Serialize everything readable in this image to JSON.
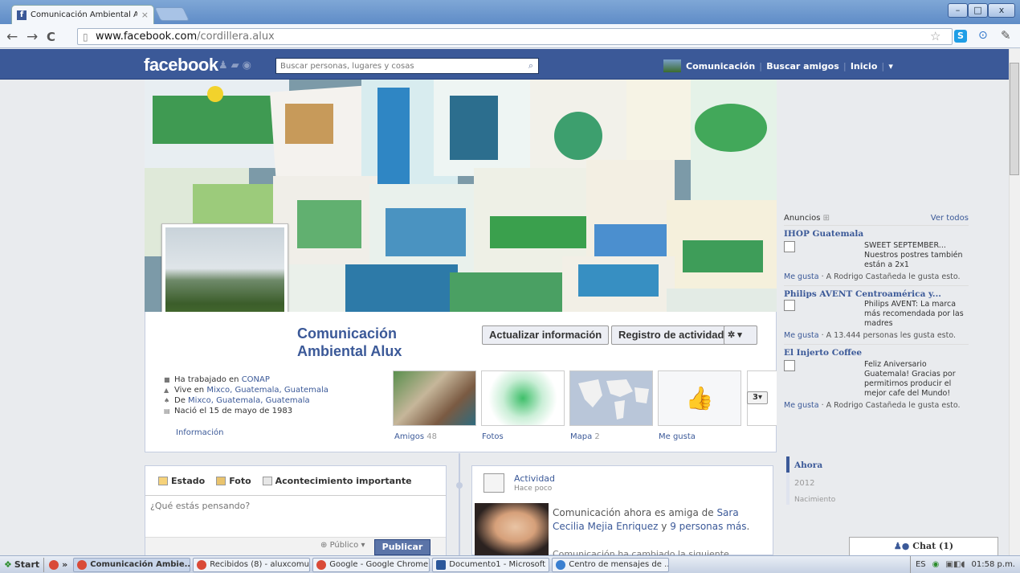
{
  "browser": {
    "tab_title": "Comunicación Ambiental Alux",
    "tab_close": "×",
    "url_domain": "www.facebook.com",
    "url_path": "/cordillera.alux",
    "back": "←",
    "forward": "→",
    "reload": "C",
    "win_min": "–",
    "win_max": "□",
    "win_close": "x"
  },
  "fb": {
    "logo": "facebook",
    "search_placeholder": "Buscar personas, lugares y cosas",
    "nav": {
      "page": "Comunicación",
      "find_friends": "Buscar amigos",
      "home": "Inicio",
      "menu": "▾"
    }
  },
  "profile": {
    "name_line1": "Comunicación",
    "name_line2": "Ambiental Alux",
    "btn_update": "Actualizar información",
    "btn_activity": "Registro de actividad",
    "btn_gear": "✲ ▾",
    "info": [
      {
        "icon": "work-icon",
        "pre": "Ha trabajado en ",
        "link": "CONAP",
        "post": ""
      },
      {
        "icon": "home-icon",
        "pre": "Vive en ",
        "link": "Mixco, Guatemala, Guatemala",
        "post": ""
      },
      {
        "icon": "hometown-icon",
        "pre": "De ",
        "link": "Mixco, Guatemala, Guatemala",
        "post": ""
      },
      {
        "icon": "birthday-icon",
        "pre": "Nació el 15 de mayo de 1983",
        "link": "",
        "post": ""
      }
    ],
    "info_link": "Información",
    "tiles": {
      "amigos": "Amigos",
      "amigos_count": "48",
      "fotos": "Fotos",
      "mapa": "Mapa",
      "mapa_count": "2",
      "megusta": "Me gusta",
      "more": "3▾"
    }
  },
  "composer": {
    "tab_estado": "Estado",
    "tab_foto": "Foto",
    "tab_evento": "Acontecimiento importante",
    "placeholder": "¿Qué estás pensando?",
    "privacy": "Público ▾",
    "publish": "Publicar"
  },
  "activity": {
    "title": "Actividad",
    "subtitle": "Hace poco",
    "text_pre": "Comunicación ahora es amiga de ",
    "friend": "Sara Cecilia Mejia Enriquez",
    "text_mid": " y ",
    "others": "9 personas más",
    "text_post": ".",
    "text2": "Comunicación ha cambiado la siguiente"
  },
  "ads": {
    "header": "Anuncios",
    "see_all": "Ver todos",
    "items": [
      {
        "title": "IHOP Guatemala",
        "text": "SWEET SEPTEMBER... Nuestros postres también están a 2x1",
        "like": "Me gusta",
        "social": " · A Rodrigo Castañeda le gusta esto."
      },
      {
        "title": "Philips AVENT Centroamérica y...",
        "text": "Philips AVENT: La marca más recomendada por las madres",
        "like": "Me gusta",
        "social": " · A 13.444 personas les gusta esto."
      },
      {
        "title": "El Injerto Coffee",
        "text": "Feliz Aniversario Guatemala! Gracias por permitirnos producir el mejor cafe del Mundo!",
        "like": "Me gusta",
        "social": " · A Rodrigo Castañeda le gusta esto."
      }
    ]
  },
  "timeline_nav": {
    "now": "Ahora",
    "year": "2012",
    "birth": "Nacimiento"
  },
  "chat": {
    "label": "Chat (1)"
  },
  "taskbar": {
    "start": "Start",
    "more": "»",
    "items": [
      {
        "label": "Comunicación Ambie...",
        "active": true
      },
      {
        "label": "Recibidos (8) - aluxcomu...",
        "active": false
      },
      {
        "label": "Google - Google Chrome",
        "active": false
      },
      {
        "label": "Documento1 - Microsoft ...",
        "active": false
      },
      {
        "label": "Centro de mensajes de ...",
        "active": false
      }
    ],
    "lang": "ES",
    "clock": "01:58 p.m."
  }
}
